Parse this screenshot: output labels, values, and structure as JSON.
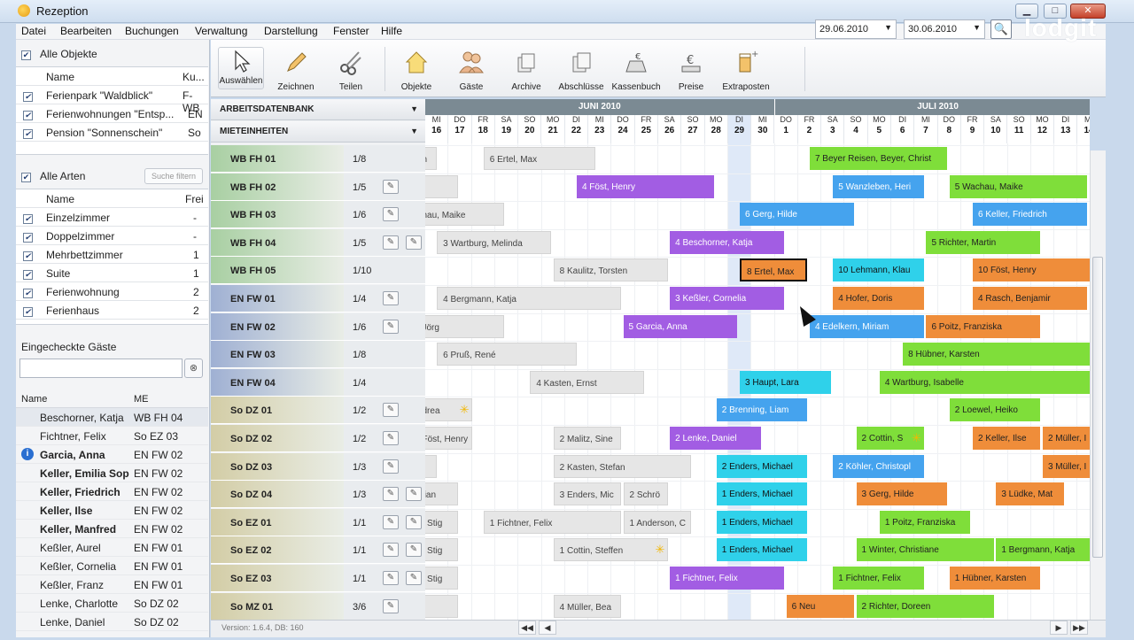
{
  "window": {
    "title": "Rezeption"
  },
  "menu": [
    "Datei",
    "Bearbeiten",
    "Buchungen",
    "Verwaltung",
    "Darstellung",
    "Fenster",
    "Hilfe"
  ],
  "objects": {
    "all_label": "Alle Objekte",
    "col_name": "Name",
    "col_short": "Ku...",
    "rows": [
      {
        "name": "Ferienpark \"Waldblick\"",
        "short": "F-WB"
      },
      {
        "name": "Ferienwohnungen \"Entsp...",
        "short": "EN"
      },
      {
        "name": "Pension \"Sonnenschein\"",
        "short": "So"
      }
    ]
  },
  "types": {
    "all_label": "Alle Arten",
    "filter_placeholder": "Suche filtern",
    "col_name": "Name",
    "col_free": "Frei",
    "rows": [
      {
        "name": "Einzelzimmer",
        "free": "-"
      },
      {
        "name": "Doppelzimmer",
        "free": "-"
      },
      {
        "name": "Mehrbettzimmer",
        "free": "1"
      },
      {
        "name": "Suite",
        "free": "1"
      },
      {
        "name": "Ferienwohnung",
        "free": "2"
      },
      {
        "name": "Ferienhaus",
        "free": "2"
      }
    ]
  },
  "guests": {
    "title": "Eingecheckte Gäste",
    "col_name": "Name",
    "col_unit": "ME",
    "rows": [
      {
        "name": "Beschorner, Katja",
        "unit": "WB FH 04"
      },
      {
        "name": "Fichtner, Felix",
        "unit": "So EZ 03"
      },
      {
        "name": "Garcia, Anna",
        "unit": "EN FW 02"
      },
      {
        "name": "Keller, Emilia Sop",
        "unit": "EN FW 02"
      },
      {
        "name": "Keller, Friedrich",
        "unit": "EN FW 02"
      },
      {
        "name": "Keller, Ilse",
        "unit": "EN FW 02"
      },
      {
        "name": "Keller, Manfred",
        "unit": "EN FW 02"
      },
      {
        "name": "Keßler, Aurel",
        "unit": "EN FW 01"
      },
      {
        "name": "Keßler, Cornelia",
        "unit": "EN FW 01"
      },
      {
        "name": "Keßler, Franz",
        "unit": "EN FW 01"
      },
      {
        "name": "Lenke, Charlotte",
        "unit": "So DZ 02"
      },
      {
        "name": "Lenke, Daniel",
        "unit": "So DZ 02"
      }
    ]
  },
  "toolbar": {
    "tools": [
      "Auswählen",
      "Zeichnen",
      "Teilen",
      "Objekte",
      "Gäste",
      "Archive",
      "Abschlüsse",
      "Kassenbuch",
      "Preise",
      "Extraposten"
    ],
    "date_from": "29.06.2010",
    "date_to": "30.06.2010",
    "logo": "lodgit"
  },
  "units": {
    "dropdown1": "ARBEITSDATENBANK",
    "dropdown2": "MIETEINHEITEN",
    "rows": [
      {
        "name": "WB FH 01",
        "cap": "1/8"
      },
      {
        "name": "WB FH 02",
        "cap": "1/5"
      },
      {
        "name": "WB FH 03",
        "cap": "1/6"
      },
      {
        "name": "WB FH 04",
        "cap": "1/5"
      },
      {
        "name": "WB FH 05",
        "cap": "1/10"
      },
      {
        "name": "EN FW 01",
        "cap": "1/4"
      },
      {
        "name": "EN FW 02",
        "cap": "1/6"
      },
      {
        "name": "EN FW 03",
        "cap": "1/8"
      },
      {
        "name": "EN FW 04",
        "cap": "1/4"
      },
      {
        "name": "So DZ 01",
        "cap": "1/2"
      },
      {
        "name": "So DZ 02",
        "cap": "1/2"
      },
      {
        "name": "So DZ 03",
        "cap": "1/3"
      },
      {
        "name": "So DZ 04",
        "cap": "1/3"
      },
      {
        "name": "So EZ 01",
        "cap": "1/1"
      },
      {
        "name": "So EZ 02",
        "cap": "1/1"
      },
      {
        "name": "So EZ 03",
        "cap": "1/1"
      },
      {
        "name": "So MZ 01",
        "cap": "3/6"
      }
    ]
  },
  "calendar": {
    "months": [
      "JUNI 2010",
      "JULI 2010"
    ],
    "days": [
      [
        "MI",
        "16"
      ],
      [
        "DO",
        "17"
      ],
      [
        "FR",
        "18"
      ],
      [
        "SA",
        "19"
      ],
      [
        "SO",
        "20"
      ],
      [
        "MO",
        "21"
      ],
      [
        "DI",
        "22"
      ],
      [
        "MI",
        "23"
      ],
      [
        "DO",
        "24"
      ],
      [
        "FR",
        "25"
      ],
      [
        "SA",
        "26"
      ],
      [
        "SO",
        "27"
      ],
      [
        "MO",
        "28"
      ],
      [
        "DI",
        "29"
      ],
      [
        "MI",
        "30"
      ],
      [
        "DO",
        "1"
      ],
      [
        "FR",
        "2"
      ],
      [
        "SA",
        "3"
      ],
      [
        "SO",
        "4"
      ],
      [
        "MO",
        "5"
      ],
      [
        "DI",
        "6"
      ],
      [
        "MI",
        "7"
      ],
      [
        "DO",
        "8"
      ],
      [
        "FR",
        "9"
      ],
      [
        "SA",
        "10"
      ],
      [
        "SO",
        "11"
      ],
      [
        "MO",
        "12"
      ],
      [
        "DI",
        "13"
      ],
      [
        "MI",
        "14"
      ]
    ],
    "bookings": [
      {
        "row": 0,
        "label": "n",
        "color": "gray",
        "start": -0.4,
        "days": 0.9
      },
      {
        "row": 0,
        "label": "6 Ertel, Max",
        "color": "gray",
        "start": 2.5,
        "days": 4.8
      },
      {
        "row": 0,
        "label": "7 Beyer Reisen, Beyer, Christ",
        "color": "green",
        "start": 16.5,
        "days": 5.9
      },
      {
        "row": 1,
        "label": "",
        "color": "gray",
        "start": -0.4,
        "days": 1.8
      },
      {
        "row": 1,
        "label": "4 Föst, Henry",
        "color": "purple",
        "start": 6.5,
        "days": 5.9
      },
      {
        "row": 1,
        "label": "5 Wanzleben, Heri",
        "color": "blue",
        "start": 17.5,
        "days": 3.9
      },
      {
        "row": 1,
        "label": "5 Wachau, Maike",
        "color": "green",
        "start": 22.5,
        "days": 5.9
      },
      {
        "row": 2,
        "label": "hau, Maike",
        "color": "gray",
        "start": -0.4,
        "days": 3.8
      },
      {
        "row": 2,
        "label": "6 Gerg, Hilde",
        "color": "blue",
        "start": 13.5,
        "days": 4.9
      },
      {
        "row": 2,
        "label": "6 Keller, Friedrich",
        "color": "blue",
        "start": 23.5,
        "days": 4.9
      },
      {
        "row": 3,
        "label": "3 Wartburg, Melinda",
        "color": "gray",
        "start": 0.5,
        "days": 4.9
      },
      {
        "row": 3,
        "label": "4 Beschorner, Katja",
        "color": "purple",
        "start": 10.5,
        "days": 4.9
      },
      {
        "row": 3,
        "label": "5 Richter, Martin",
        "color": "green",
        "start": 21.5,
        "days": 4.9
      },
      {
        "row": 4,
        "label": "8 Kaulitz, Torsten",
        "color": "gray",
        "start": 5.5,
        "days": 4.9
      },
      {
        "row": 4,
        "label": "8 Ertel, Max",
        "color": "orange",
        "start": 13.5,
        "days": 2.9,
        "selected": true
      },
      {
        "row": 4,
        "label": "10 Lehmann, Klau",
        "color": "cyan",
        "start": 17.5,
        "days": 3.9
      },
      {
        "row": 4,
        "label": "10 Föst, Henry",
        "color": "orange",
        "start": 23.5,
        "days": 5.9
      },
      {
        "row": 5,
        "label": "4 Bergmann, Katja",
        "color": "gray",
        "start": 0.5,
        "days": 7.9
      },
      {
        "row": 5,
        "label": "3 Keßler, Cornelia",
        "color": "purple",
        "start": 10.5,
        "days": 4.9
      },
      {
        "row": 5,
        "label": "4 Hofer, Doris",
        "color": "orange",
        "start": 17.5,
        "days": 3.9
      },
      {
        "row": 5,
        "label": "4 Rasch, Benjamir",
        "color": "orange",
        "start": 23.5,
        "days": 4.9
      },
      {
        "row": 6,
        "label": "Jörg",
        "color": "gray",
        "start": -0.4,
        "days": 3.8
      },
      {
        "row": 6,
        "label": "5 Garcia, Anna",
        "color": "purple",
        "start": 8.5,
        "days": 4.9
      },
      {
        "row": 6,
        "label": "4 Edelkern, Miriam",
        "color": "blue",
        "start": 16.5,
        "days": 4.9
      },
      {
        "row": 6,
        "label": "6 Poitz, Franziska",
        "color": "orange",
        "start": 21.5,
        "days": 4.9
      },
      {
        "row": 7,
        "label": "6 Pruß, René",
        "color": "gray",
        "start": 0.5,
        "days": 6.0
      },
      {
        "row": 7,
        "label": "8 Hübner, Karsten",
        "color": "green",
        "start": 20.5,
        "days": 8.0
      },
      {
        "row": 8,
        "label": "4 Kasten, Ernst",
        "color": "gray",
        "start": 4.5,
        "days": 4.9
      },
      {
        "row": 8,
        "label": "3 Haupt, Lara",
        "color": "cyan",
        "start": 13.5,
        "days": 3.9
      },
      {
        "row": 8,
        "label": "4 Wartburg, Isabelle",
        "color": "green",
        "start": 19.5,
        "days": 9.0
      },
      {
        "row": 9,
        "label": "drea",
        "color": "gray",
        "start": -0.4,
        "days": 2.4,
        "star": true
      },
      {
        "row": 9,
        "label": "2 Brenning, Liam",
        "color": "blue",
        "start": 12.5,
        "days": 3.9
      },
      {
        "row": 9,
        "label": "2 Loewel, Heiko",
        "color": "green",
        "start": 22.5,
        "days": 3.9
      },
      {
        "row": 10,
        "label": "Föst, Henry",
        "color": "gray",
        "start": -0.4,
        "days": 2.4
      },
      {
        "row": 10,
        "label": "2 Malitz, Sine",
        "color": "gray",
        "start": 5.5,
        "days": 2.9
      },
      {
        "row": 10,
        "label": "2 Lenke, Daniel",
        "color": "purple",
        "start": 10.5,
        "days": 3.9
      },
      {
        "row": 10,
        "label": "2 Cottin, S",
        "color": "green",
        "start": 18.5,
        "days": 2.9,
        "star": true
      },
      {
        "row": 10,
        "label": "2 Keller, Ilse",
        "color": "orange",
        "start": 23.5,
        "days": 2.9
      },
      {
        "row": 10,
        "label": "2 Müller, I",
        "color": "orange",
        "start": 26.5,
        "days": 2.9
      },
      {
        "row": 11,
        "label": "",
        "color": "gray",
        "start": -0.4,
        "days": 0.9
      },
      {
        "row": 11,
        "label": "2 Kasten, Stefan",
        "color": "gray",
        "start": 5.5,
        "days": 5.9
      },
      {
        "row": 11,
        "label": "2 Enders, Michael",
        "color": "cyan",
        "start": 12.5,
        "days": 3.9
      },
      {
        "row": 11,
        "label": "2 Köhler, Christopl",
        "color": "blue",
        "start": 17.5,
        "days": 3.9
      },
      {
        "row": 11,
        "label": "3 Müller, I",
        "color": "orange",
        "start": 26.5,
        "days": 2.9
      },
      {
        "row": 12,
        "label": "lian",
        "color": "gray",
        "start": -0.4,
        "days": 1.8
      },
      {
        "row": 12,
        "label": "3 Enders, Mic",
        "color": "gray",
        "start": 5.5,
        "days": 2.9
      },
      {
        "row": 12,
        "label": "2 Schrö",
        "color": "gray",
        "start": 8.5,
        "days": 1.9
      },
      {
        "row": 12,
        "label": "1 Enders, Michael",
        "color": "cyan",
        "start": 12.5,
        "days": 3.9
      },
      {
        "row": 12,
        "label": "3 Gerg, Hilde",
        "color": "orange",
        "start": 18.5,
        "days": 3.9
      },
      {
        "row": 12,
        "label": "3 Lüdke, Mat",
        "color": "orange",
        "start": 24.5,
        "days": 2.9
      },
      {
        "row": 13,
        "label": ", Stig",
        "color": "gray",
        "start": -0.4,
        "days": 1.8
      },
      {
        "row": 13,
        "label": "1 Fichtner, Felix",
        "color": "gray",
        "start": 2.5,
        "days": 5.9
      },
      {
        "row": 13,
        "label": "1 Anderson, C",
        "color": "gray",
        "start": 8.5,
        "days": 2.9
      },
      {
        "row": 13,
        "label": "1 Enders, Michael",
        "color": "cyan",
        "start": 12.5,
        "days": 3.9
      },
      {
        "row": 13,
        "label": "1 Poitz, Franziska",
        "color": "green",
        "start": 19.5,
        "days": 3.9
      },
      {
        "row": 14,
        "label": ", Stig",
        "color": "gray",
        "start": -0.4,
        "days": 1.8
      },
      {
        "row": 14,
        "label": "1 Cottin, Steffen",
        "color": "gray",
        "start": 5.5,
        "days": 4.9,
        "star": true
      },
      {
        "row": 14,
        "label": "1 Enders, Michael",
        "color": "cyan",
        "start": 12.5,
        "days": 3.9
      },
      {
        "row": 14,
        "label": "1 Winter, Christiane",
        "color": "green",
        "start": 18.5,
        "days": 5.9
      },
      {
        "row": 14,
        "label": "1 Bergmann, Katja",
        "color": "green",
        "start": 24.5,
        "days": 4.0
      },
      {
        "row": 15,
        "label": ", Stig",
        "color": "gray",
        "start": -0.4,
        "days": 1.8
      },
      {
        "row": 15,
        "label": "1 Fichtner, Felix",
        "color": "purple",
        "start": 10.5,
        "days": 4.9
      },
      {
        "row": 15,
        "label": "1 Fichtner, Felix",
        "color": "green",
        "start": 17.5,
        "days": 3.9
      },
      {
        "row": 15,
        "label": "1 Hübner, Karsten",
        "color": "orange",
        "start": 22.5,
        "days": 3.9
      },
      {
        "row": 16,
        "label": "",
        "color": "gray",
        "start": -0.4,
        "days": 1.8
      },
      {
        "row": 16,
        "label": "4 Müller, Bea",
        "color": "gray",
        "start": 5.5,
        "days": 2.9
      },
      {
        "row": 16,
        "label": "6 Neu",
        "color": "orange",
        "start": 15.5,
        "days": 2.9
      },
      {
        "row": 16,
        "label": "2 Richter, Doreen",
        "color": "green",
        "start": 18.5,
        "days": 5.9
      }
    ]
  },
  "status": {
    "version": "Version: 1.6.4, DB: 160"
  }
}
